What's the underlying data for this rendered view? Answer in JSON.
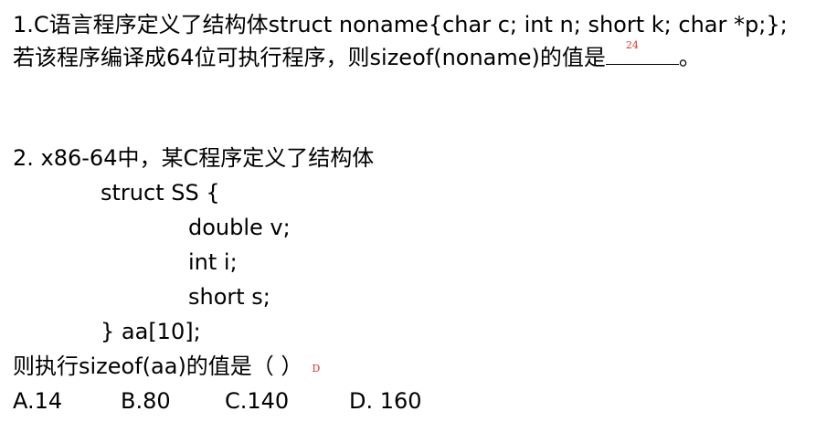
{
  "question1": {
    "line1": "1.C语言程序定义了结构体struct noname{char c; int n; short k; char *p;};",
    "line2_prefix": "若该程序编译成64位可执行程序，则sizeof(noname)的值是",
    "answer": "24",
    "line2_suffix": "。"
  },
  "question2": {
    "title": "2. x86-64中，某C程序定义了结构体",
    "code_open": "struct SS {",
    "fields": [
      "double v;",
      "int i;",
      "short s;"
    ],
    "code_close": "} aa[10];",
    "ask": "则执行sizeof(aa)的值是（   ）",
    "answer": "D",
    "options": [
      "A.14",
      "B.80",
      "C.140",
      "D. 160"
    ]
  },
  "colors": {
    "text": "#000000",
    "answer_mark": "#d9362b"
  }
}
